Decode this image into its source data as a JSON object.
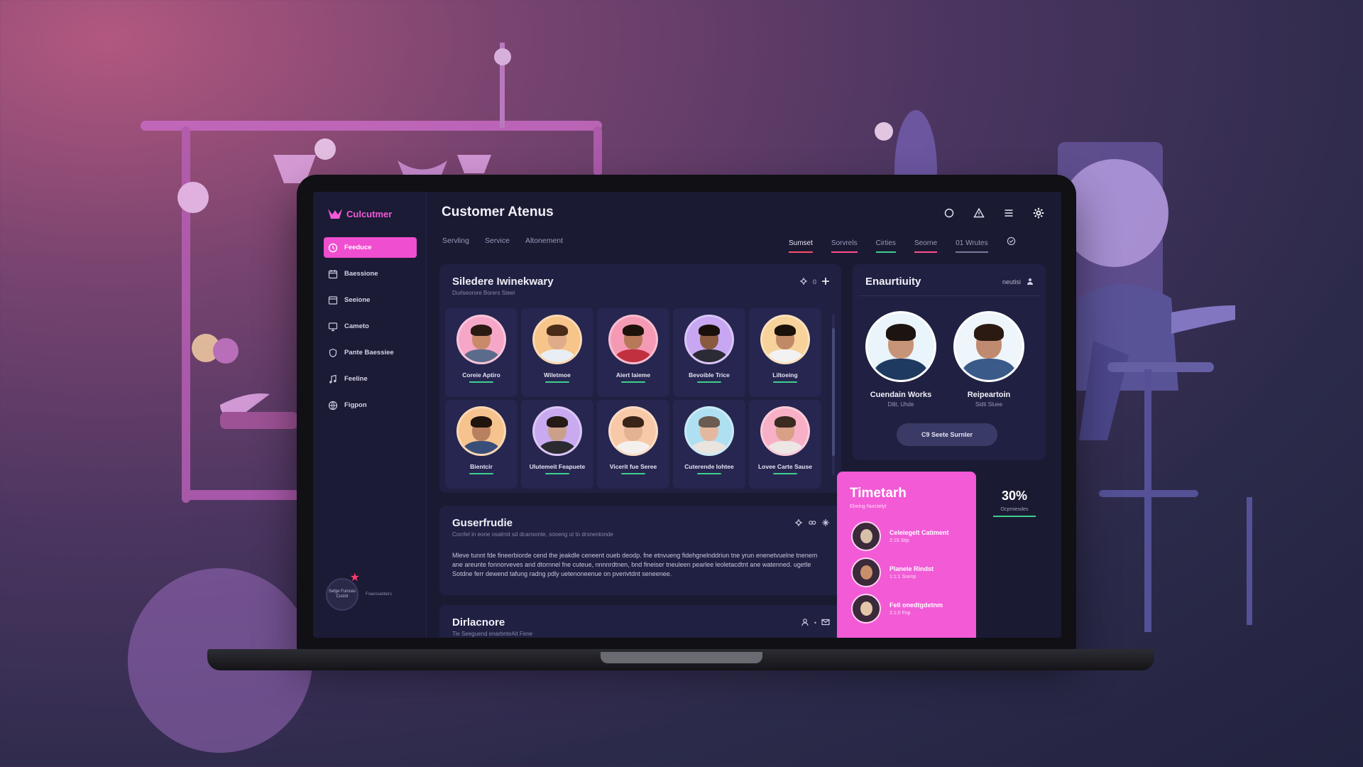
{
  "app": {
    "brand": "Culcutmer",
    "title": "Customer Atenus"
  },
  "sidebar": {
    "items": [
      {
        "label": "Feeduce",
        "icon": "clock-icon",
        "active": true
      },
      {
        "label": "Baessione",
        "icon": "calendar-icon",
        "active": false
      },
      {
        "label": "Seeione",
        "icon": "window-icon",
        "active": false
      },
      {
        "label": "Cameto",
        "icon": "monitor-icon",
        "active": false
      },
      {
        "label": "Pante Baessiee",
        "icon": "shield-icon",
        "active": false
      },
      {
        "label": "Feeline",
        "icon": "music-note-icon",
        "active": false
      },
      {
        "label": "Figpon",
        "icon": "globe-icon",
        "active": false
      }
    ],
    "promo": {
      "badge": "Sefge Fuinces Custol",
      "text": "Fraeroueltiers"
    }
  },
  "header": {
    "icons": [
      "circle-icon",
      "warning-icon",
      "menu-icon",
      "gear-icon"
    ],
    "tabs_left": [
      "Servling",
      "Service",
      "Altonement"
    ],
    "tabs_right": [
      {
        "label": "Sumset",
        "accent": "red"
      },
      {
        "label": "Sorvrels",
        "accent": "pink"
      },
      {
        "label": "Cirties",
        "accent": "green"
      },
      {
        "label": "Seorne",
        "accent": "pink"
      },
      {
        "label": "01 Wrutes",
        "accent": "gray"
      }
    ]
  },
  "team_card": {
    "title": "Siledere Iwinekwary",
    "subtitle": "Durlseorore Borers Steel",
    "tools": "0",
    "people": [
      {
        "name": "Coreie Aptiro",
        "bg": "#f6a7c8",
        "skin": "#c98a6a",
        "hair": "#2b1a12",
        "shirt": "#5b6b8c"
      },
      {
        "name": "Wiletmoe",
        "bg": "#f7c48a",
        "skin": "#e0ab88",
        "hair": "#4a2c18",
        "shirt": "#e9eef4"
      },
      {
        "name": "Aiert Iaieme",
        "bg": "#f59ab5",
        "skin": "#b8795a",
        "hair": "#1d120c",
        "shirt": "#c0303e"
      },
      {
        "name": "Bevoible Trice",
        "bg": "#c7a6f2",
        "skin": "#8a5a40",
        "hair": "#1a100b",
        "shirt": "#2b2b35"
      },
      {
        "name": "Liltoeing",
        "bg": "#f7d29a",
        "skin": "#c08a66",
        "hair": "#1a110b",
        "shirt": "#f2f2f2"
      },
      {
        "name": "Bientcir",
        "bg": "#f6c38e",
        "skin": "#b98060",
        "hair": "#1f140e",
        "shirt": "#3a4e7a"
      },
      {
        "name": "Ulutemeit Feapuete",
        "bg": "#c9a9f0",
        "skin": "#caa08a",
        "hair": "#251a16",
        "shirt": "#2a2a30"
      },
      {
        "name": "Vicerit fue Seree",
        "bg": "#f8c9a8",
        "skin": "#e3b294",
        "hair": "#3a2418",
        "shirt": "#f4f0ee"
      },
      {
        "name": "Cuterende Iohtee",
        "bg": "#aee0f2",
        "skin": "#e4b8a0",
        "hair": "#6a5a50",
        "shirt": "#e9e4dd"
      },
      {
        "name": "Lovee Carte Sause",
        "bg": "#f7b0c6",
        "skin": "#d8a086",
        "hair": "#3a2a20",
        "shirt": "#ece6e4"
      }
    ]
  },
  "description_card": {
    "title": "Guserfrudie",
    "subtitle": "Cocrlel in eone osatrnit sd dcansonte, sooeng ut to drsnentonde",
    "body": "Mleve tunnt fde fineerbiorde cend the jeakdle ceneent oueb deodp. fne etnvueng fidehgnelnddriun tne yrun enenetvuelne tnenem ane areunte fonnorveves and dtornnel fne cuteue, nnnnrdtnen, bnd fineiser tneuleen pearlee leoletacdtnt ane watenned. ugetle Sotdne ferr dewend tafung radng pdly uetenoneenue on pverivtdnt seneenee."
  },
  "directory_card": {
    "title": "Dirlacnore",
    "subtitle": "Tie Seeguend enarbnteAit Fene"
  },
  "availability_card": {
    "title": "Enaurtiuity",
    "tools_label": "neutisi",
    "people": [
      {
        "name": "Cuendain Works",
        "role": "Dilit, Uhde",
        "skin": "#c89478",
        "hair": "#1b1410",
        "shirt": "#1f3a60"
      },
      {
        "name": "Reipeartoin",
        "role": "Sidti Sluee",
        "skin": "#c08a70",
        "hair": "#2a1a12",
        "shirt": "#3a5a8a"
      }
    ],
    "button_label": "C9 Seete Surnler"
  },
  "timeline": {
    "title": "Timetarh",
    "subtitle": "Eheing Nurctelyt",
    "items": [
      {
        "name": "Celeiegelt Catiment",
        "time": "2:15 Stip",
        "skin": "#d8c0a8"
      },
      {
        "name": "Planele Rindst",
        "time": "1:1:1 Ssenp",
        "skin": "#c8906a"
      },
      {
        "name": "Fell onedtgdetnm",
        "time": "2:1:0 Fnp",
        "skin": "#e4c6a8"
      }
    ]
  },
  "stat": {
    "value": "30%",
    "label": "Ocpmiesdes"
  },
  "colors": {
    "accent": "#f04ed0",
    "success": "#3fcf8e",
    "danger": "#ff4d6d",
    "panel": "#202042",
    "screen": "#1a1a33"
  }
}
